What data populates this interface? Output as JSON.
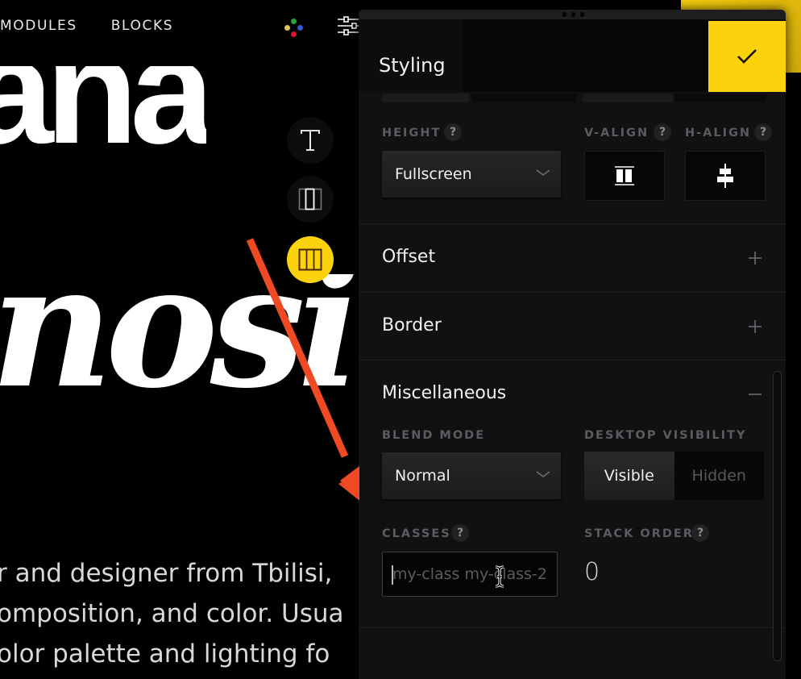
{
  "background_page": {
    "nav": [
      "MODULES",
      "BLOCKS"
    ],
    "logo_dot_colors": [
      "#27a33b",
      "#e4c25e",
      "#2d5bd8",
      "#e0162f"
    ],
    "headline_top": "ana",
    "headline_mid": "nosi",
    "body_lines": [
      "r and designer from Tbilisi,",
      "omposition, and color. Usua",
      "olor palette and lighting fo"
    ],
    "tool_buttons": [
      "text-tool",
      "column-tool",
      "row-layout-tool"
    ]
  },
  "annotation": {
    "arrow_color": "#f04a24"
  },
  "panel": {
    "title": "Styling",
    "accent_color": "#fcd20c",
    "confirm_icon": "check-icon",
    "height_field": {
      "label": "HEIGHT",
      "help": "?",
      "value": "Fullscreen"
    },
    "valign_field": {
      "label": "V-ALIGN",
      "help": "?",
      "icon": "valign-stretch-icon"
    },
    "halign_field": {
      "label": "H-ALIGN",
      "help": "?",
      "icon": "halign-center-icon"
    },
    "sections": [
      {
        "title": "Offset",
        "state": "collapsed",
        "icon": "+"
      },
      {
        "title": "Border",
        "state": "collapsed",
        "icon": "+"
      },
      {
        "title": "Miscellaneous",
        "state": "expanded",
        "icon": "−"
      }
    ],
    "misc": {
      "blend_mode": {
        "label": "BLEND MODE",
        "value": "Normal"
      },
      "desktop_visibility": {
        "label": "DESKTOP VISIBILITY",
        "options": [
          "Visible",
          "Hidden"
        ],
        "selected": "Visible"
      },
      "classes": {
        "label": "CLASSES",
        "help": "?",
        "value": "",
        "placeholder": "my-class my-class-2"
      },
      "stack_order": {
        "label": "STACK ORDER",
        "help": "?",
        "value": "0"
      }
    }
  }
}
